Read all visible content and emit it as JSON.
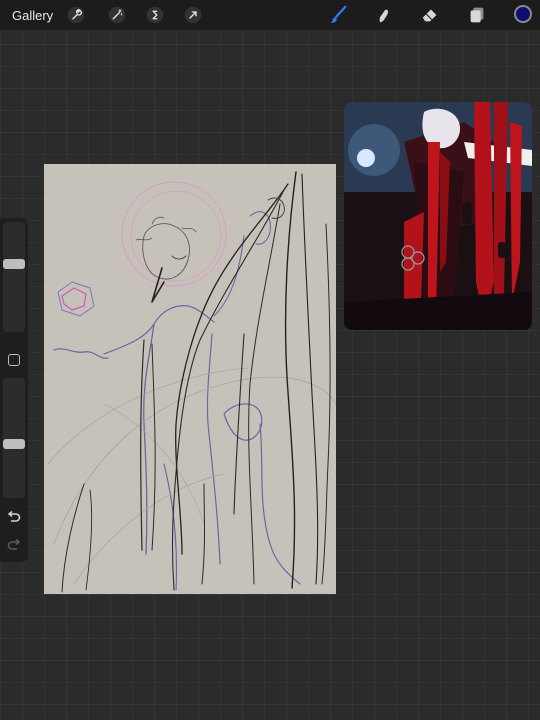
{
  "topbar": {
    "gallery_label": "Gallery",
    "left_tools": [
      {
        "name": "wrench-icon",
        "role": "Actions"
      },
      {
        "name": "magic-wand-icon",
        "role": "Adjustments"
      },
      {
        "name": "selection-s-icon",
        "role": "Selection"
      },
      {
        "name": "transform-arrow-icon",
        "role": "Transform"
      }
    ],
    "right_tools": [
      {
        "name": "brush-icon",
        "active": true
      },
      {
        "name": "smudge-icon",
        "active": false
      },
      {
        "name": "eraser-icon",
        "active": false
      },
      {
        "name": "layers-icon",
        "active": false
      }
    ],
    "active_color": "#0e0e6e",
    "accent_color": "#2f7cf6"
  },
  "sidebar": {
    "brush_size_level": 0.63,
    "opacity_level": 0.45,
    "icons": [
      "modify-square-icon",
      "undo-icon",
      "redo-icon"
    ]
  },
  "canvas": {
    "paper_color": "#c6c2ba",
    "sketch_colors": [
      "#6a66a6",
      "#2b2b2b",
      "#d89ac6",
      "#a9a6a0"
    ]
  },
  "reference": {
    "image_colors": [
      "#1a1014",
      "#b3121a",
      "#e8e8f0",
      "#5a7ca8"
    ]
  }
}
